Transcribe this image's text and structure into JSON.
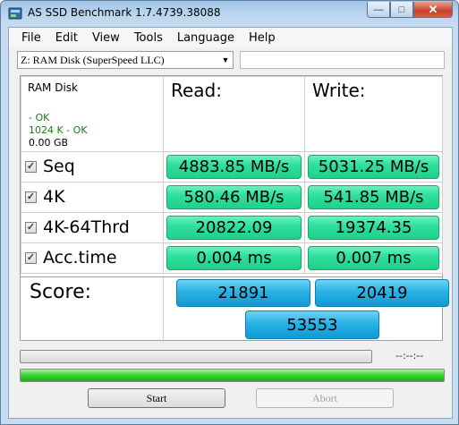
{
  "window": {
    "title": "AS SSD Benchmark 1.7.4739.38088"
  },
  "menu": {
    "items": [
      "File",
      "Edit",
      "View",
      "Tools",
      "Language",
      "Help"
    ]
  },
  "drive": {
    "selected": "Z: RAM Disk (SuperSpeed LLC)",
    "text_box_value": ""
  },
  "info": {
    "drive_name": "RAM Disk",
    "line1": " - OK",
    "line2": "1024 K - OK",
    "capacity": "0.00 GB"
  },
  "headers": {
    "read": "Read:",
    "write": "Write:"
  },
  "rows": [
    {
      "label": "Seq",
      "read": "4883.85 MB/s",
      "write": "5031.25 MB/s",
      "checked": true
    },
    {
      "label": "4K",
      "read": "580.46 MB/s",
      "write": "541.85 MB/s",
      "checked": true
    },
    {
      "label": "4K-64Thrd",
      "read": "20822.09",
      "write": "19374.35",
      "checked": true
    },
    {
      "label": "Acc.time",
      "read": "0.004 ms",
      "write": "0.007 ms",
      "checked": true
    }
  ],
  "score": {
    "label": "Score:",
    "read": "21891",
    "write": "20419",
    "total": "53553"
  },
  "progress": {
    "time_text": "--:--:--",
    "small_fraction": 0.0,
    "big_fraction": 1.0
  },
  "buttons": {
    "start": "Start",
    "abort": "Abort"
  },
  "colors": {
    "result_green": "#2fe09e",
    "score_blue": "#27b3e6",
    "ok_text": "#1a7a1a",
    "progress_green": "#3fd43a"
  },
  "icons": {
    "app": "app-icon",
    "minimize": "minimize-icon",
    "maximize": "maximize-icon",
    "close": "close-icon",
    "dropdown": "chevron-down-icon",
    "checkbox": "checkmark-icon"
  }
}
